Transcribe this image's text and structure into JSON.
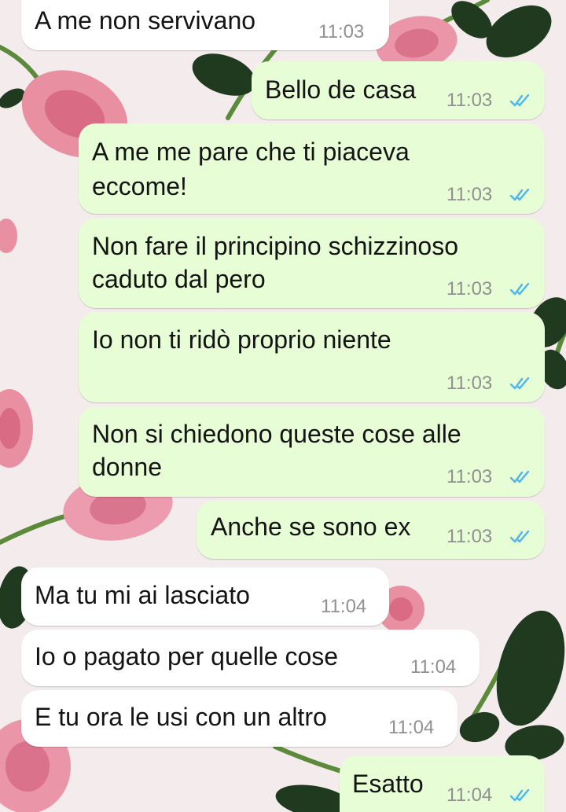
{
  "chat": {
    "messages": [
      {
        "direction": "incoming",
        "lines": [
          "A me non servivano"
        ],
        "time": "11:03"
      },
      {
        "direction": "outgoing",
        "lines": [
          "Bello de casa"
        ],
        "time": "11:03",
        "status": "read"
      },
      {
        "direction": "outgoing",
        "lines": [
          "A me me pare che ti piaceva",
          "eccome!"
        ],
        "time": "11:03",
        "status": "read"
      },
      {
        "direction": "outgoing",
        "lines": [
          "Non fare il principino schizzinoso",
          "caduto dal pero"
        ],
        "time": "11:03",
        "status": "read"
      },
      {
        "direction": "outgoing",
        "lines": [
          "Io non ti ridò proprio niente"
        ],
        "time": "11:03",
        "status": "read"
      },
      {
        "direction": "outgoing",
        "lines": [
          "Non si chiedono queste cose alle",
          "donne"
        ],
        "time": "11:03",
        "status": "read"
      },
      {
        "direction": "outgoing",
        "lines": [
          "Anche se sono ex"
        ],
        "time": "11:03",
        "status": "read"
      },
      {
        "direction": "incoming",
        "lines": [
          "Ma tu mi ai lasciato"
        ],
        "time": "11:04"
      },
      {
        "direction": "incoming",
        "lines": [
          "Io o pagato per quelle cose"
        ],
        "time": "11:04"
      },
      {
        "direction": "incoming",
        "lines": [
          "E tu ora le usi con un altro"
        ],
        "time": "11:04"
      },
      {
        "direction": "outgoing",
        "lines": [
          "Esatto"
        ],
        "time": "11:04",
        "status": "read"
      }
    ]
  },
  "theme": {
    "incoming_bubble": "#ffffff",
    "outgoing_bubble": "#e7fdd6",
    "read_tick_color": "#4fb6ec",
    "wallpaper": "pink-roses"
  }
}
